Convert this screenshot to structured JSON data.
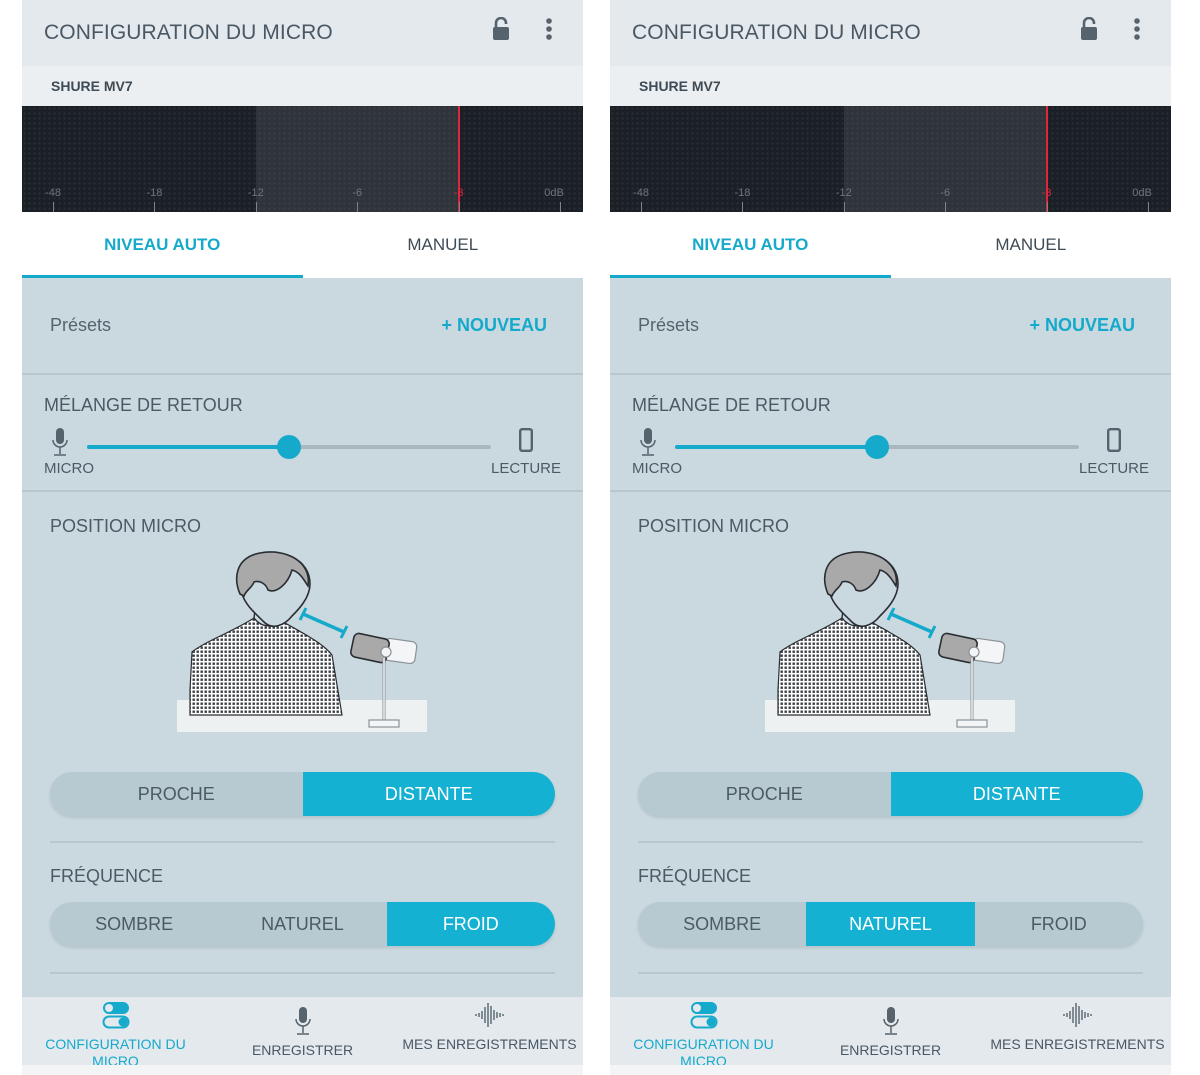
{
  "colors": {
    "accent": "#15aacb",
    "peak": "#e0263c",
    "content_bg": "#cad9df",
    "appbar_bg": "#e3e9ed",
    "meter_bg": "#1b2026"
  },
  "screens": [
    {
      "appbar": {
        "title": "CONFIGURATION DU MICRO",
        "lock_icon": "unlocked-padlock-icon",
        "menu_icon": "more-vertical-icon"
      },
      "device": {
        "name": "SHURE MV7"
      },
      "meter": {
        "scale": [
          {
            "label": "-48",
            "peak": false
          },
          {
            "label": "-18",
            "peak": false
          },
          {
            "label": "-12",
            "peak": false
          },
          {
            "label": "-6",
            "peak": false
          },
          {
            "label": "-3",
            "peak": true
          },
          {
            "label": "0dB",
            "peak": false
          }
        ],
        "target_zone_db": [
          -12,
          -3
        ],
        "peak_marker_db": -3
      },
      "tabs": [
        {
          "label": "NIVEAU AUTO",
          "active": true
        },
        {
          "label": "MANUEL",
          "active": false
        }
      ],
      "presets": {
        "label": "Présets",
        "new_button": "+ NOUVEAU"
      },
      "monitor_mix": {
        "title": "MÉLANGE DE RETOUR",
        "left_label": "MICRO",
        "right_label": "LECTURE",
        "left_icon": "microphone-icon",
        "right_icon": "smartphone-icon",
        "value_percent": 50
      },
      "mic_position": {
        "title": "POSITION MICRO",
        "options": [
          {
            "label": "PROCHE",
            "selected": false
          },
          {
            "label": "DISTANTE",
            "selected": true
          }
        ]
      },
      "tone": {
        "title": "FRÉQUENCE",
        "options": [
          {
            "label": "SOMBRE",
            "selected": false
          },
          {
            "label": "NATUREL",
            "selected": false
          },
          {
            "label": "FROID",
            "selected": true
          }
        ]
      },
      "bottom_nav": [
        {
          "label": "CONFIGURATION DU MICRO",
          "icon": "toggles-icon",
          "active": true
        },
        {
          "label": "ENREGISTRER",
          "icon": "microphone-icon",
          "active": false
        },
        {
          "label": "MES ENREGISTREMENTS",
          "icon": "waveform-icon",
          "active": false
        }
      ]
    },
    {
      "appbar": {
        "title": "CONFIGURATION DU MICRO",
        "lock_icon": "unlocked-padlock-icon",
        "menu_icon": "more-vertical-icon"
      },
      "device": {
        "name": "SHURE MV7"
      },
      "meter": {
        "scale": [
          {
            "label": "-48",
            "peak": false
          },
          {
            "label": "-18",
            "peak": false
          },
          {
            "label": "-12",
            "peak": false
          },
          {
            "label": "-6",
            "peak": false
          },
          {
            "label": "-3",
            "peak": true
          },
          {
            "label": "0dB",
            "peak": false
          }
        ],
        "target_zone_db": [
          -12,
          -3
        ],
        "peak_marker_db": -3
      },
      "tabs": [
        {
          "label": "NIVEAU AUTO",
          "active": true
        },
        {
          "label": "MANUEL",
          "active": false
        }
      ],
      "presets": {
        "label": "Présets",
        "new_button": "+ NOUVEAU"
      },
      "monitor_mix": {
        "title": "MÉLANGE DE RETOUR",
        "left_label": "MICRO",
        "right_label": "LECTURE",
        "left_icon": "microphone-icon",
        "right_icon": "smartphone-icon",
        "value_percent": 50
      },
      "mic_position": {
        "title": "POSITION MICRO",
        "options": [
          {
            "label": "PROCHE",
            "selected": false
          },
          {
            "label": "DISTANTE",
            "selected": true
          }
        ]
      },
      "tone": {
        "title": "FRÉQUENCE",
        "options": [
          {
            "label": "SOMBRE",
            "selected": false
          },
          {
            "label": "NATUREL",
            "selected": true
          },
          {
            "label": "FROID",
            "selected": false
          }
        ]
      },
      "bottom_nav": [
        {
          "label": "CONFIGURATION DU MICRO",
          "icon": "toggles-icon",
          "active": true
        },
        {
          "label": "ENREGISTRER",
          "icon": "microphone-icon",
          "active": false
        },
        {
          "label": "MES ENREGISTREMENTS",
          "icon": "waveform-icon",
          "active": false
        }
      ]
    }
  ]
}
